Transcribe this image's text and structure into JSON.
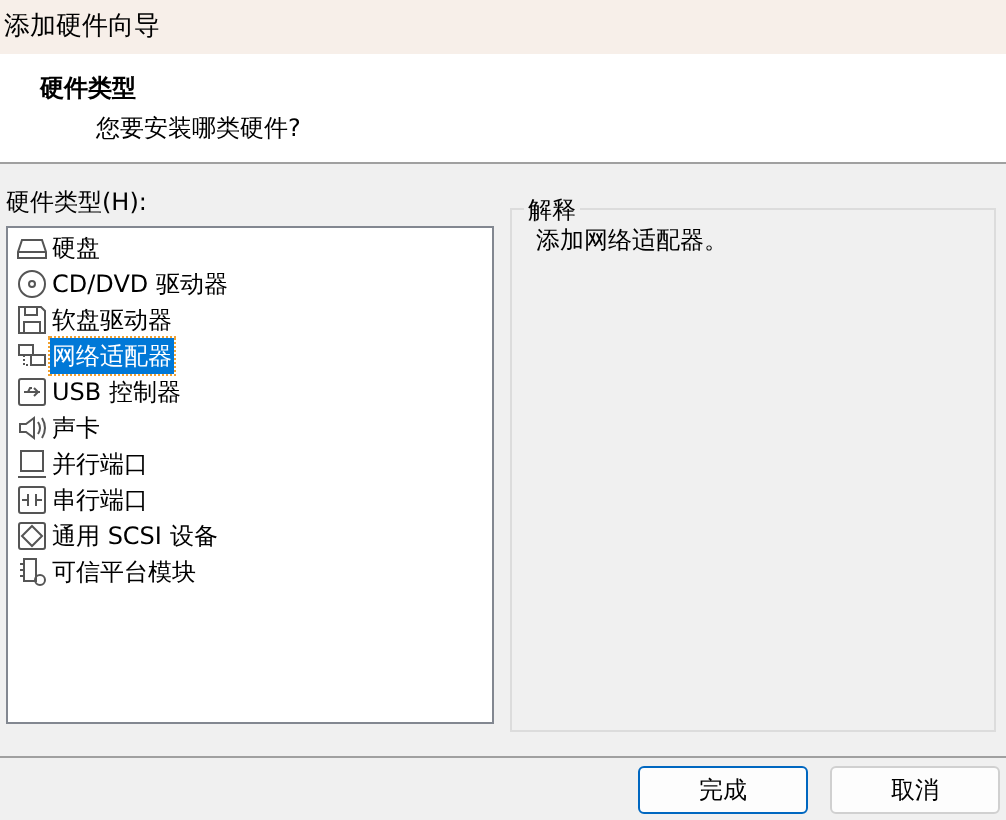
{
  "window": {
    "title": "添加硬件向导"
  },
  "header": {
    "title": "硬件类型",
    "subtitle": "您要安装哪类硬件?"
  },
  "list_label": "硬件类型(H):",
  "hardware_types": [
    {
      "label": "硬盘",
      "kind": "disk",
      "selected": false
    },
    {
      "label": "CD/DVD 驱动器",
      "kind": "cd",
      "selected": false
    },
    {
      "label": "软盘驱动器",
      "kind": "floppy",
      "selected": false
    },
    {
      "label": "网络适配器",
      "kind": "network",
      "selected": true
    },
    {
      "label": "USB 控制器",
      "kind": "usb",
      "selected": false
    },
    {
      "label": "声卡",
      "kind": "sound",
      "selected": false
    },
    {
      "label": "并行端口",
      "kind": "parallel",
      "selected": false
    },
    {
      "label": "串行端口",
      "kind": "serial",
      "selected": false
    },
    {
      "label": "通用 SCSI 设备",
      "kind": "scsi",
      "selected": false
    },
    {
      "label": "可信平台模块",
      "kind": "tpm",
      "selected": false
    }
  ],
  "explanation": {
    "legend": "解释",
    "text": "添加网络适配器。"
  },
  "buttons": [
    {
      "label": "完成",
      "focused": true
    },
    {
      "label": "取消",
      "focused": false
    }
  ]
}
